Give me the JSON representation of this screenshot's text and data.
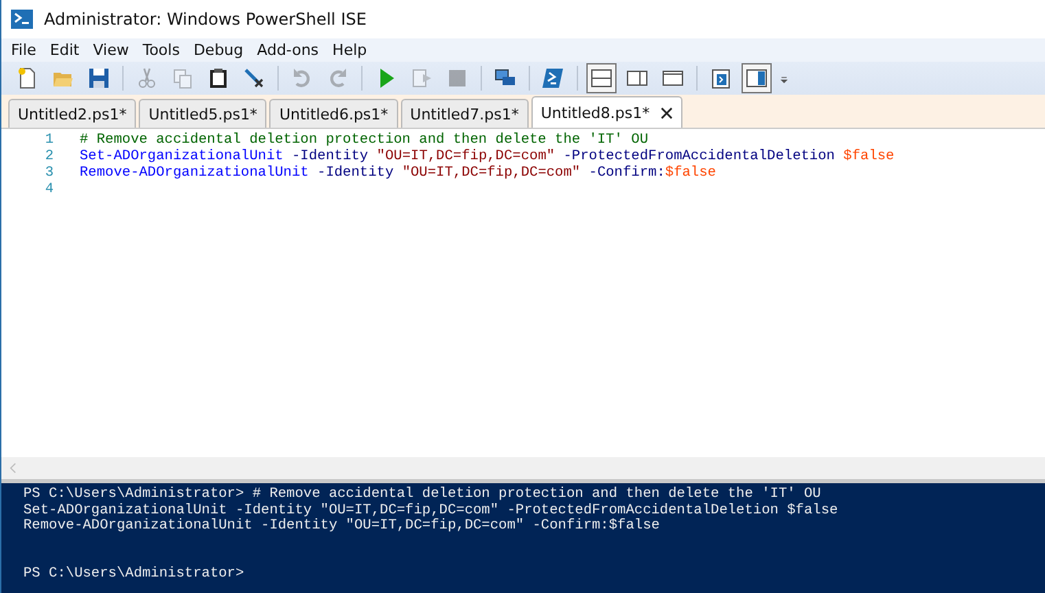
{
  "window": {
    "title": "Administrator: Windows PowerShell ISE"
  },
  "menu": [
    "File",
    "Edit",
    "View",
    "Tools",
    "Debug",
    "Add-ons",
    "Help"
  ],
  "toolbar": [
    {
      "kind": "new",
      "disabled": false
    },
    {
      "kind": "open",
      "disabled": false
    },
    {
      "kind": "save",
      "disabled": false
    },
    {
      "kind": "sep"
    },
    {
      "kind": "cut",
      "disabled": true
    },
    {
      "kind": "copy",
      "disabled": true
    },
    {
      "kind": "paste",
      "disabled": false
    },
    {
      "kind": "clear",
      "disabled": false
    },
    {
      "kind": "sep"
    },
    {
      "kind": "undo",
      "disabled": true
    },
    {
      "kind": "redo",
      "disabled": true
    },
    {
      "kind": "sep"
    },
    {
      "kind": "run",
      "disabled": false
    },
    {
      "kind": "runsel",
      "disabled": true
    },
    {
      "kind": "stop",
      "disabled": true
    },
    {
      "kind": "sep"
    },
    {
      "kind": "remote",
      "disabled": false
    },
    {
      "kind": "sep"
    },
    {
      "kind": "console",
      "disabled": false
    },
    {
      "kind": "sep"
    },
    {
      "kind": "layout-top",
      "selected": true
    },
    {
      "kind": "layout-right",
      "selected": false
    },
    {
      "kind": "layout-max",
      "selected": false
    },
    {
      "kind": "sep"
    },
    {
      "kind": "script-pane",
      "selected": false
    },
    {
      "kind": "addons",
      "selected": true
    },
    {
      "kind": "overflow"
    }
  ],
  "tabs": [
    {
      "label": "Untitled2.ps1*",
      "selected": false
    },
    {
      "label": "Untitled5.ps1*",
      "selected": false
    },
    {
      "label": "Untitled6.ps1*",
      "selected": false
    },
    {
      "label": "Untitled7.ps1*",
      "selected": false
    },
    {
      "label": "Untitled8.ps1*",
      "selected": true
    }
  ],
  "editor": {
    "lines": [
      {
        "number": "1",
        "tokens": [
          {
            "kind": "comment",
            "text": "# Remove accidental deletion protection and then delete the 'IT' OU"
          }
        ]
      },
      {
        "number": "2",
        "tokens": [
          {
            "kind": "cmdlet",
            "text": "Set-ADOrganizationalUnit"
          },
          {
            "kind": "param",
            "text": " -Identity "
          },
          {
            "kind": "string",
            "text": "\"OU=IT,DC=fip,DC=com\""
          },
          {
            "kind": "param",
            "text": " -ProtectedFromAccidentalDeletion "
          },
          {
            "kind": "variable",
            "text": "$false"
          }
        ]
      },
      {
        "number": "3",
        "tokens": [
          {
            "kind": "cmdlet",
            "text": "Remove-ADOrganizationalUnit"
          },
          {
            "kind": "param",
            "text": " -Identity "
          },
          {
            "kind": "string",
            "text": "\"OU=IT,DC=fip,DC=com\""
          },
          {
            "kind": "param",
            "text": " -Confirm:"
          },
          {
            "kind": "variable",
            "text": "$false"
          }
        ]
      },
      {
        "number": "4"
      }
    ]
  },
  "console": {
    "lines": [
      "PS C:\\Users\\Administrator> # Remove accidental deletion protection and then delete the 'IT' OU",
      "Set-ADOrganizationalUnit -Identity \"OU=IT,DC=fip,DC=com\" -ProtectedFromAccidentalDeletion $false",
      "Remove-ADOrganizationalUnit -Identity \"OU=IT,DC=fip,DC=com\" -Confirm:$false"
    ],
    "prompt": "PS C:\\Users\\Administrator>"
  }
}
